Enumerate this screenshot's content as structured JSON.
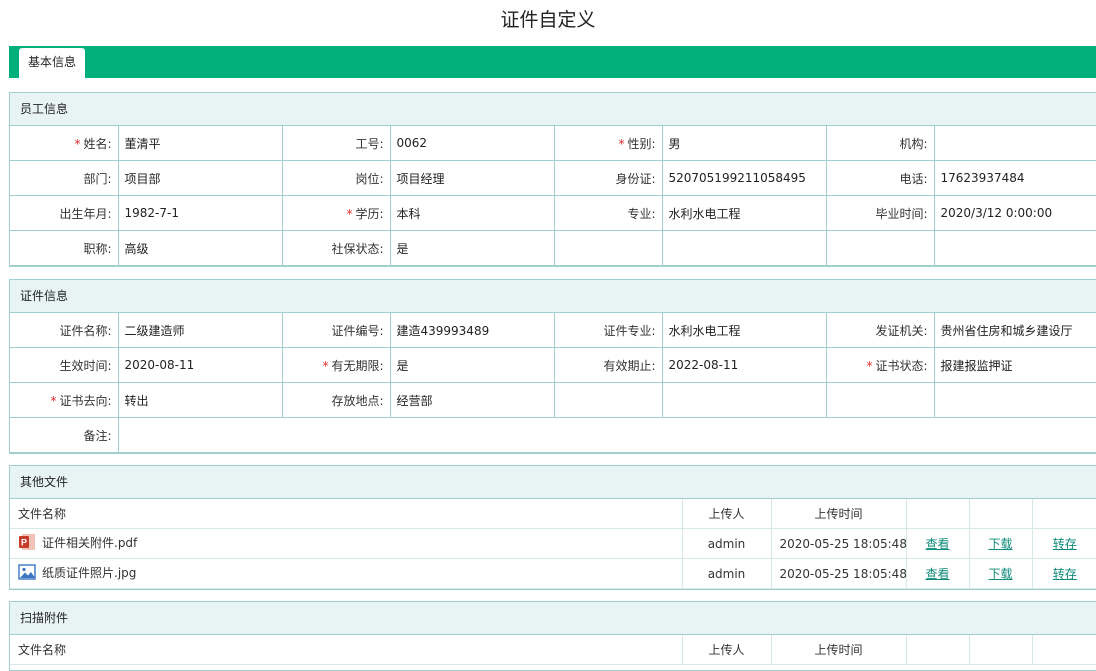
{
  "page_title": "证件自定义",
  "tab": "基本信息",
  "employee": {
    "section_title": "员工信息",
    "rows": [
      [
        {
          "label": "姓名:",
          "value": "董清平",
          "req": true
        },
        {
          "label": "工号:",
          "value": "0062",
          "req": false
        },
        {
          "label": "性别:",
          "value": "男",
          "req": true
        },
        {
          "label": "机构:",
          "value": "",
          "req": false
        }
      ],
      [
        {
          "label": "部门:",
          "value": "项目部",
          "req": false
        },
        {
          "label": "岗位:",
          "value": "项目经理",
          "req": false
        },
        {
          "label": "身份证:",
          "value": "520705199211058495",
          "req": false
        },
        {
          "label": "电话:",
          "value": "17623937484",
          "req": false
        }
      ],
      [
        {
          "label": "出生年月:",
          "value": "1982-7-1",
          "req": false
        },
        {
          "label": "学历:",
          "value": "本科",
          "req": true
        },
        {
          "label": "专业:",
          "value": "水利水电工程",
          "req": false
        },
        {
          "label": "毕业时间:",
          "value": "2020/3/12 0:00:00",
          "req": false
        }
      ],
      [
        {
          "label": "职称:",
          "value": "高级",
          "req": false
        },
        {
          "label": "社保状态:",
          "value": "是",
          "req": false
        },
        {
          "label": "",
          "value": "",
          "req": false
        },
        {
          "label": "",
          "value": "",
          "req": false
        }
      ]
    ]
  },
  "certificate": {
    "section_title": "证件信息",
    "rows": [
      [
        {
          "label": "证件名称:",
          "value": "二级建造师",
          "req": false
        },
        {
          "label": "证件编号:",
          "value": "建造439993489",
          "req": false
        },
        {
          "label": "证件专业:",
          "value": "水利水电工程",
          "req": false
        },
        {
          "label": "发证机关:",
          "value": "贵州省住房和城乡建设厅",
          "req": false
        }
      ],
      [
        {
          "label": "生效时间:",
          "value": "2020-08-11",
          "req": false
        },
        {
          "label": "有无期限:",
          "value": "是",
          "req": true
        },
        {
          "label": "有效期止:",
          "value": "2022-08-11",
          "req": false
        },
        {
          "label": "证书状态:",
          "value": "报建报监押证",
          "req": true
        }
      ],
      [
        {
          "label": "证书去向:",
          "value": "转出",
          "req": true
        },
        {
          "label": "存放地点:",
          "value": "经营部",
          "req": false
        },
        {
          "label": "",
          "value": "",
          "req": false
        },
        {
          "label": "",
          "value": "",
          "req": false
        }
      ]
    ],
    "remark_label": "备注:",
    "remark_value": ""
  },
  "other_files": {
    "section_title": "其他文件",
    "headers": {
      "name": "文件名称",
      "uploader": "上传人",
      "time": "上传时间"
    },
    "files": [
      {
        "icon": "pdf-file-icon",
        "name": "证件相关附件.pdf",
        "uploader": "admin",
        "time": "2020-05-25 18:05:48",
        "view": "查看",
        "download": "下载",
        "transfer": "转存"
      },
      {
        "icon": "image-file-icon",
        "name": "纸质证件照片.jpg",
        "uploader": "admin",
        "time": "2020-05-25 18:05:48",
        "view": "查看",
        "download": "下载",
        "transfer": "转存"
      }
    ]
  },
  "scan_files": {
    "section_title": "扫描附件",
    "headers": {
      "name": "文件名称",
      "uploader": "上传人",
      "time": "上传时间"
    }
  },
  "colors": {
    "accent": "#00af7a",
    "border": "#9fcfcf",
    "header_bg": "#e8f4f3",
    "required": "#e0262a",
    "link": "#0f8a7a"
  }
}
